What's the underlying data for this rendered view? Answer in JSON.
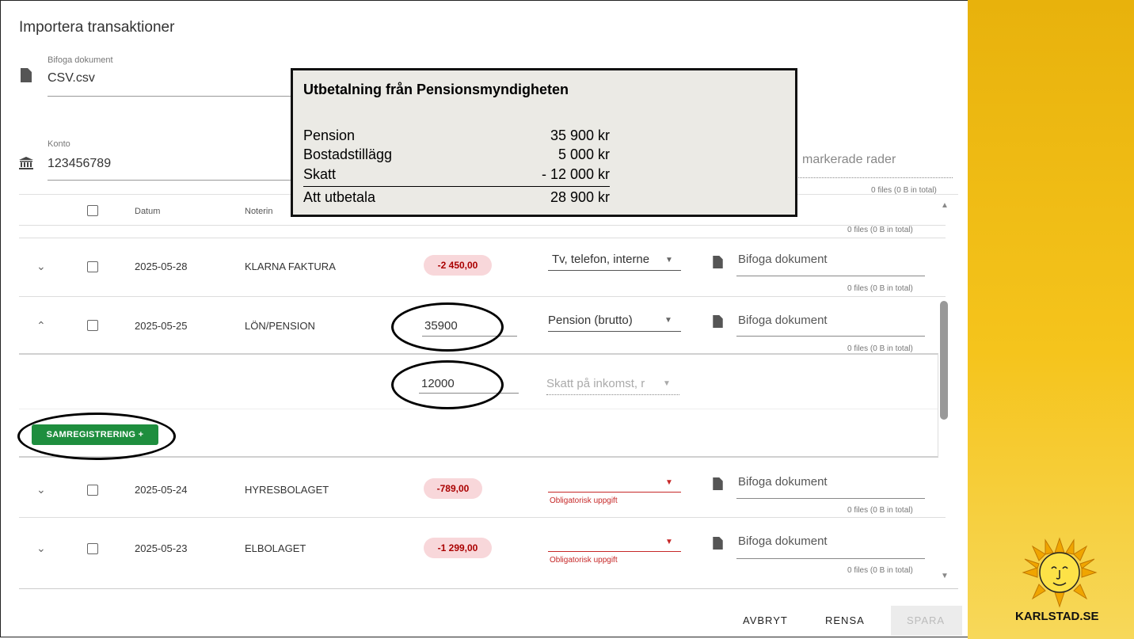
{
  "dialog": {
    "title": "Importera transaktioner",
    "attach": {
      "label": "Bifoga dokument",
      "value": "CSV.csv"
    },
    "account": {
      "label": "Konto",
      "value": "123456789"
    },
    "marked_rows_placeholder": "markerade rader",
    "files_total_top": "0 files (0 B in total)"
  },
  "popup": {
    "title": "Utbetalning från Pensionsmyndigheten",
    "rows": [
      {
        "label": "Pension",
        "value": "35 900 kr"
      },
      {
        "label": "Bostadstillägg",
        "value": "5 000 kr"
      },
      {
        "label": "Skatt",
        "value": "- 12 000 kr"
      },
      {
        "label": "Att utbetala",
        "value": "28 900 kr"
      }
    ]
  },
  "table": {
    "headers": {
      "date": "Datum",
      "note": "Noterin"
    },
    "files_text": "0 files (0 B in total)",
    "attach_placeholder": "Bifoga dokument",
    "required_text": "Obligatorisk uppgift",
    "rows": [
      {
        "date": "2025-05-28",
        "note": "KLARNA FAKTURA",
        "amount": "-2 450,00",
        "category": "Tv, telefon, interne"
      },
      {
        "date": "2025-05-25",
        "note": "LÖN/PENSION",
        "amount": "35900",
        "category": "Pension (brutto)"
      },
      {
        "date": "2025-05-24",
        "note": "HYRESBOLAGET",
        "amount": "-789,00",
        "category": ""
      },
      {
        "date": "2025-05-23",
        "note": "ELBOLAGET",
        "amount": "-1 299,00",
        "category": ""
      }
    ],
    "split": {
      "amount": "12000",
      "category_placeholder": "Skatt på inkomst, r"
    },
    "co_register_button": "SAMREGISTRERING +"
  },
  "footer": {
    "cancel": "AVBRYT",
    "clear": "RENSA",
    "save": "SPARA"
  },
  "brand": {
    "name": "KARLSTAD.SE"
  },
  "icons": [
    "file-icon",
    "bank-icon",
    "chevron-down-icon",
    "chevron-up-icon",
    "dropdown-caret-icon",
    "sun-logo-icon"
  ],
  "colors": {
    "accent_green": "#1e8e3e",
    "error_red": "#c62828",
    "amount_pill": "#f8d7da",
    "brand_yellow": "#f5c41c"
  }
}
